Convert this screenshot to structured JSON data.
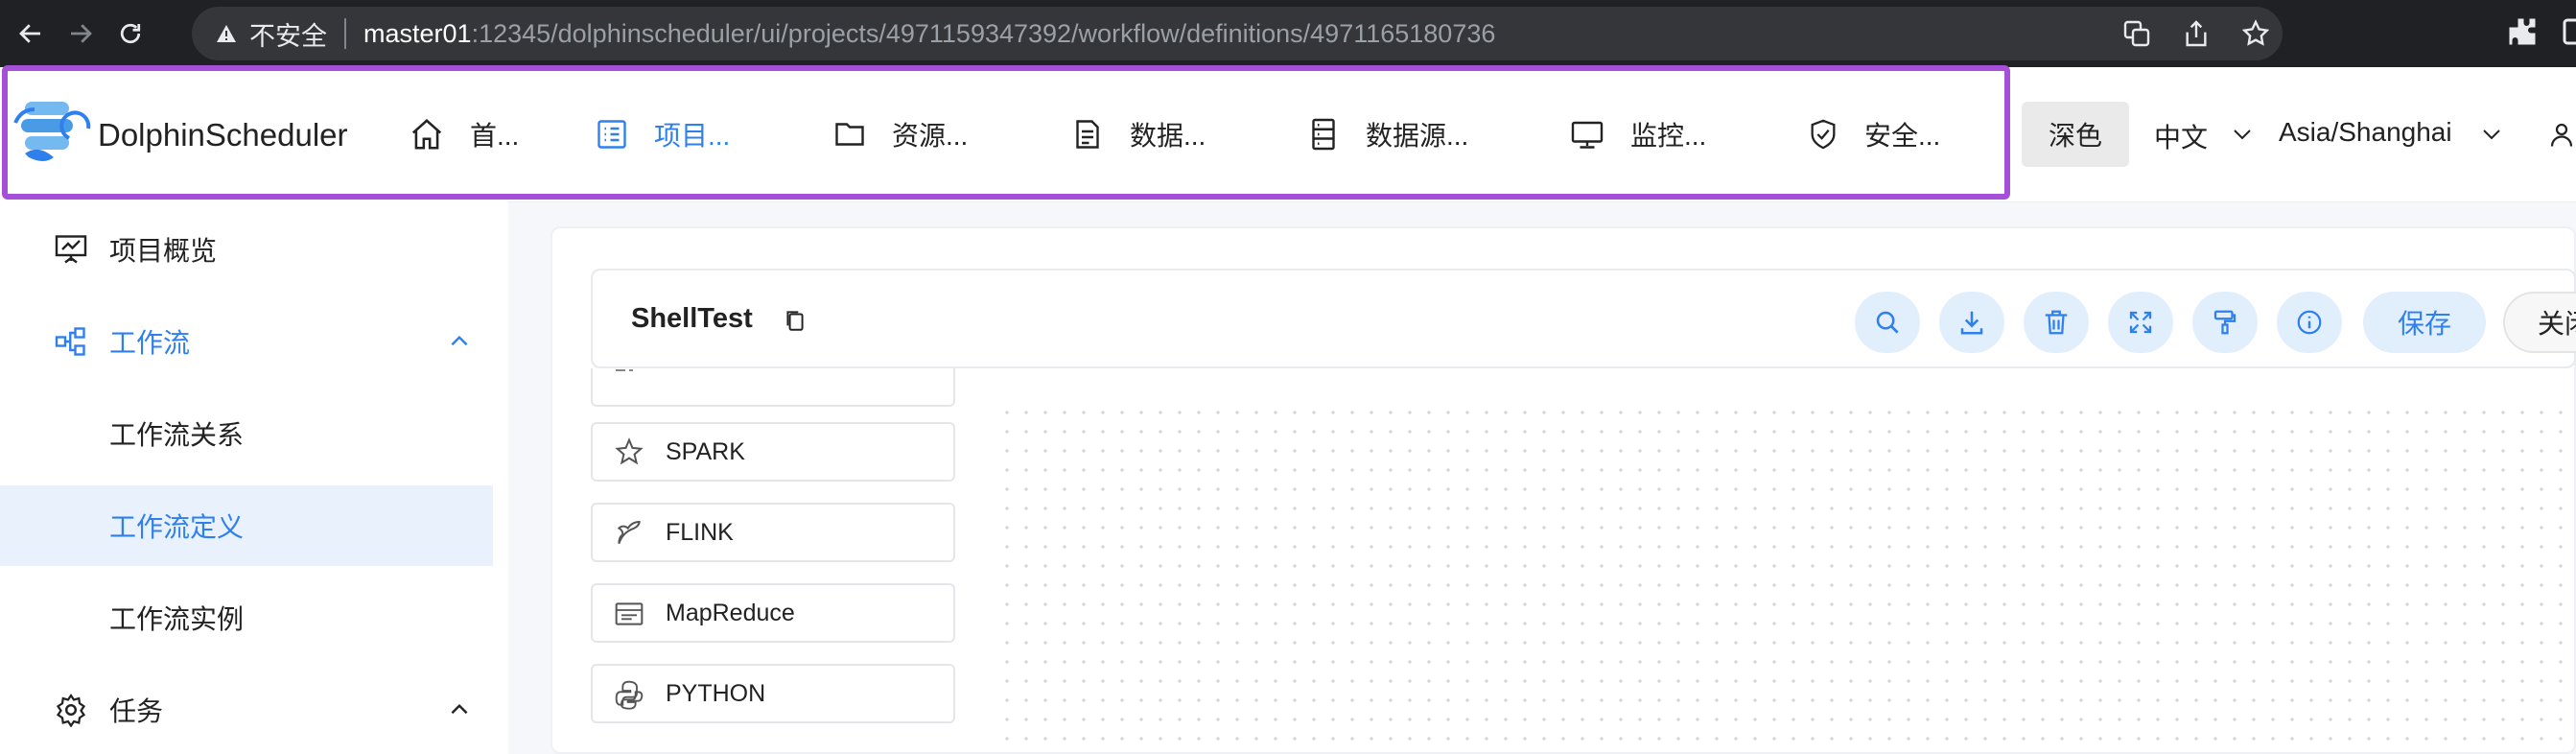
{
  "browser": {
    "insecure_label": "不安全",
    "url_host": "master01",
    "url_path": ":12345/dolphinscheduler/ui/projects/4971159347392/workflow/definitions/4971165180736"
  },
  "header": {
    "brand": "DolphinScheduler",
    "nav": [
      {
        "label": "首...",
        "icon": "home-icon"
      },
      {
        "label": "项目...",
        "icon": "project-list-icon"
      },
      {
        "label": "资源...",
        "icon": "folder-icon"
      },
      {
        "label": "数据...",
        "icon": "data-quality-icon"
      },
      {
        "label": "数据源...",
        "icon": "datasource-icon"
      },
      {
        "label": "监控...",
        "icon": "monitor-icon"
      },
      {
        "label": "安全...",
        "icon": "shield-icon"
      }
    ],
    "active_nav_index": 1,
    "theme_label": "深色",
    "language": "中文",
    "timezone": "Asia/Shanghai"
  },
  "sidebar": {
    "items": [
      {
        "label": "项目概览",
        "icon": "dashboard-icon"
      },
      {
        "label": "工作流",
        "icon": "workflow-icon",
        "expanded": true
      },
      {
        "label": "工作流关系"
      },
      {
        "label": "工作流定义",
        "selected": true
      },
      {
        "label": "工作流实例"
      },
      {
        "label": "任务",
        "icon": "gear-icon",
        "expanded": true
      }
    ]
  },
  "toolbar": {
    "workflow_name": "ShellTest",
    "buttons": [
      "search-icon",
      "download-icon",
      "delete-icon",
      "fullscreen-icon",
      "format-icon",
      "info-icon"
    ],
    "save_label": "保存",
    "close_label": "关闭"
  },
  "tasks": [
    {
      "label": "SPARK",
      "icon": "spark-icon"
    },
    {
      "label": "FLINK",
      "icon": "flink-icon"
    },
    {
      "label": "MapReduce",
      "icon": "mapreduce-icon"
    },
    {
      "label": "PYTHON",
      "icon": "python-icon"
    }
  ],
  "colors": {
    "accent": "#2f80ed",
    "highlight_border": "#a64fd9",
    "selected_bg": "#e8f1fc"
  }
}
